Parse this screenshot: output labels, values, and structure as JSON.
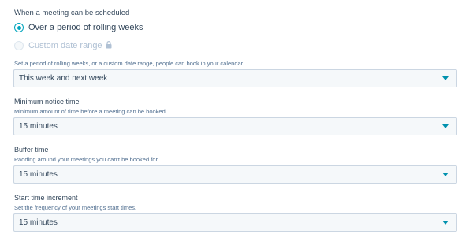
{
  "schedule": {
    "title": "When a meeting can be scheduled",
    "options": [
      {
        "label": "Over a period of rolling weeks",
        "checked": true
      },
      {
        "label": "Custom date range",
        "disabled": true,
        "icon": "lock-icon"
      }
    ],
    "help": "Set a period of rolling weeks, or a custom date range, people can book in your calendar",
    "range_value": "This week and next week"
  },
  "minimum_notice": {
    "label": "Minimum notice time",
    "help": "Minimum amount of time before a meeting can be booked",
    "value": "15 minutes"
  },
  "buffer": {
    "label": "Buffer time",
    "help": "Padding around your meetings you can't be booked for",
    "value": "15 minutes"
  },
  "increment": {
    "label": "Start time increment",
    "help": "Set the frequency of your meetings start times.",
    "value": "15 minutes"
  },
  "colors": {
    "accent": "#00a4bd",
    "caret": "#0091ae",
    "text": "#33475b",
    "input_bg": "#f5f8fa",
    "border": "#cbd6e2"
  }
}
